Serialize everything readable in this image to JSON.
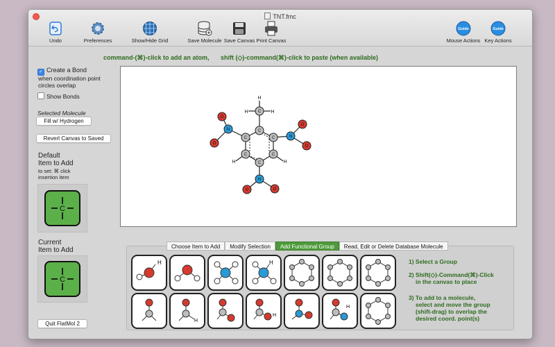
{
  "window": {
    "title": "TNT.fmc"
  },
  "toolbar": {
    "undo": "Undo",
    "preferences": "Preferences",
    "grid": "Show/Hide Grid",
    "save_molecule": "Save Molecule",
    "save_canvas": "Save Canvas",
    "print_canvas": "Print Canvas",
    "mouse_actions": "Mouse Actions",
    "key_actions": "Key Actions",
    "guide_label": "Guide"
  },
  "hints": {
    "add_atom": "command-(⌘)-click to add an atom,",
    "paste": "shift (◇)-command(⌘)-click to paste (when available)"
  },
  "left": {
    "create_bond": "Create a Bond",
    "create_bond_sub1": "when coordination point",
    "create_bond_sub2": "circles overlap",
    "show_bonds": "Show Bonds",
    "selected_molecule": "Selected Molecule",
    "fill_hydrogen": "Fill w/ Hydrogen",
    "revert": "Revert Canvas to Saved",
    "default_item_1": "Default",
    "default_item_2": "Item to Add",
    "default_set_1": "to set:  ⌘ click",
    "default_set_2": "insertion item",
    "current_item_1": "Current",
    "current_item_2": "Item to Add",
    "quit": "Quit FlatMol 2",
    "item_symbol": "C"
  },
  "tabs": [
    "Choose Item to Add",
    "Modify Selection",
    "Add Functional Group",
    "Read, Edit or Delete Database Molecule"
  ],
  "active_tab": 2,
  "instructions": {
    "step1": "1) Select a Group",
    "step2a": "2) Shift(◇)-Command(⌘)-Click",
    "step2b": "in the canvas to place",
    "step3a": "3) To add to a molecule,",
    "step3b": "select and move the group",
    "step3c": "(shift-drag)  to overlap the",
    "step3d": "desired coord. point(s)"
  },
  "colors": {
    "hint_green": "#2e6b1e",
    "tab_active": "#4e9a3b",
    "carbon": "#bdbdbd",
    "nitrogen": "#2a9ad6",
    "oxygen": "#d63a2f",
    "item_green": "#5cb04a"
  },
  "molecule_labels": {
    "C": "C",
    "H": "H",
    "N": "N",
    "O": "O"
  }
}
